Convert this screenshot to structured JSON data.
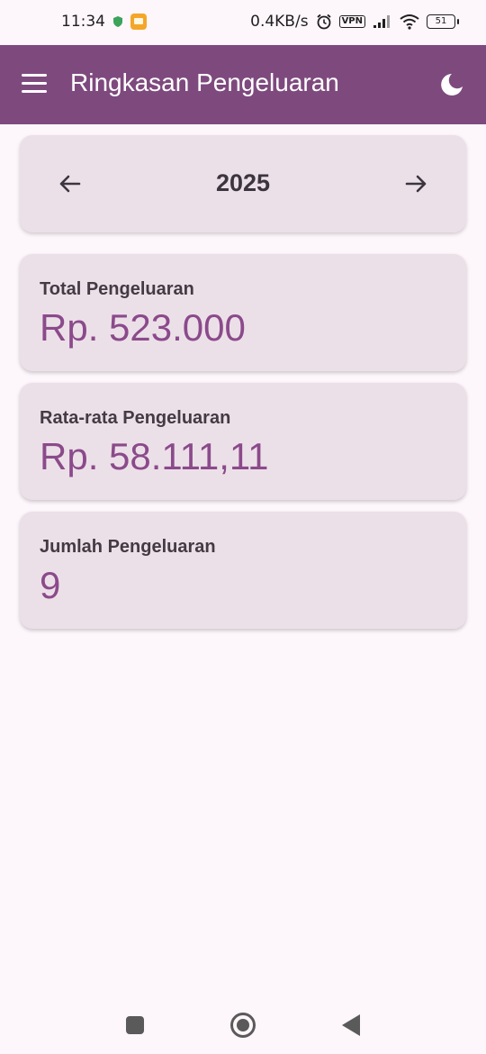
{
  "status_bar": {
    "time": "11:34",
    "network_speed": "0.4KB/s",
    "vpn_label": "VPN",
    "battery_level": "51",
    "icons": [
      "shield-icon",
      "notification-icon",
      "alarm-icon",
      "vpn-icon",
      "signal-icon",
      "wifi-icon",
      "battery-icon"
    ]
  },
  "app_bar": {
    "title": "Ringkasan Pengeluaran",
    "menu_icon": "menu-icon",
    "theme_icon": "moon-icon",
    "background_color": "#7e4a7e"
  },
  "year_selector": {
    "year": "2025",
    "prev_icon": "arrow-left-icon",
    "next_icon": "arrow-right-icon"
  },
  "stats": [
    {
      "label": "Total Pengeluaran",
      "value": "Rp. 523.000"
    },
    {
      "label": "Rata-rata Pengeluaran",
      "value": "Rp. 58.111,11"
    },
    {
      "label": "Jumlah Pengeluaran",
      "value": "9"
    }
  ],
  "colors": {
    "accent": "#8b4a8b",
    "card_background": "#ece0e8",
    "page_background": "#fdf6fb"
  },
  "system_nav": {
    "icons": [
      "recent-apps-icon",
      "home-icon",
      "back-icon"
    ]
  }
}
